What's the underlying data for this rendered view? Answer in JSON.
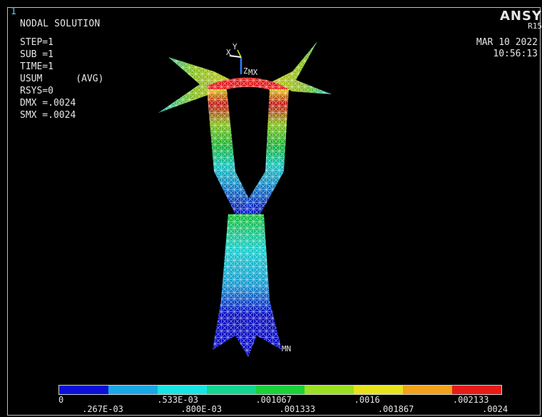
{
  "window_number": "1",
  "title": "NODAL SOLUTION",
  "info": {
    "step": "STEP=1",
    "sub": "SUB =1",
    "time": "TIME=1",
    "result": "USUM      (AVG)",
    "rsys": "RSYS=0",
    "dmx": "DMX =.0024",
    "smx": "SMX =.0024"
  },
  "brand": "ANSY",
  "release": "R15",
  "date": "MAR 10 2022",
  "clock": "10:56:13",
  "markers": {
    "max": "MX",
    "min": "MN"
  },
  "triad": {
    "x": "X",
    "y": "Y",
    "z": "Z"
  },
  "colors": {
    "background": "#000000",
    "bands": [
      "#0b10d8",
      "#1aa7e6",
      "#19e3e3",
      "#12d690",
      "#1ad13a",
      "#9be022",
      "#e6e31e",
      "#f0a21a",
      "#e71a1a"
    ]
  },
  "legend": {
    "top_labels": [
      "0",
      ".533E-03",
      ".001067",
      ".0016",
      ".002133"
    ],
    "bottom_labels": [
      ".267E-03",
      ".800E-03",
      ".001333",
      ".001867",
      ".0024"
    ]
  }
}
